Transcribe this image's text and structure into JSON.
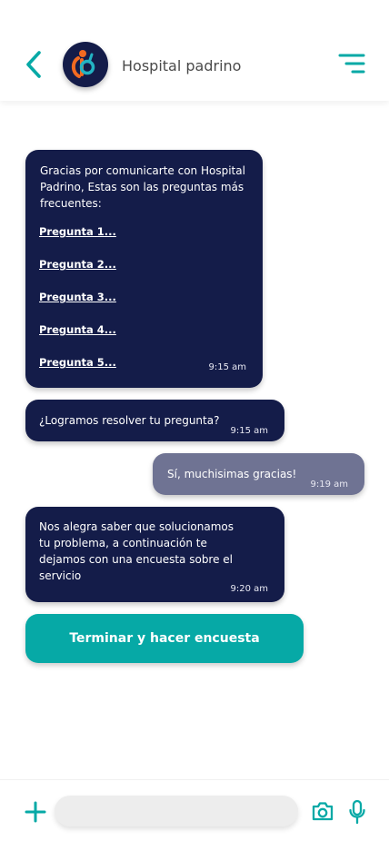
{
  "colors": {
    "accent": "#06a9a6",
    "bot_bubble": "#141c49",
    "user_bubble": "#6f7393",
    "logo_orange": "#f26a21",
    "logo_teal": "#23b3c3"
  },
  "header": {
    "back_icon": "chevron-left-icon",
    "title": "Hospital padrino",
    "menu_icon": "filter-menu-icon"
  },
  "messages": {
    "welcome": {
      "intro": "Gracias por comunicarte con Hospital Padrino, Estas son las preguntas más frecuentes:",
      "questions": [
        "Pregunta 1...",
        "Pregunta 2...",
        "Pregunta 3...",
        "Pregunta 4...",
        "Pregunta 5..."
      ],
      "time": "9:15 am"
    },
    "resolved_question": {
      "text": "¿Logramos resolver tu pregunta?",
      "time": "9:15 am"
    },
    "user_reply": {
      "text": "Sí, muchisimas gracias!",
      "time": "9:19 am"
    },
    "survey_note": {
      "text": "Nos alegra saber que solucionamos tu problema, a continuación te dejamos con una encuesta sobre el servicio",
      "time": "9:20 am"
    }
  },
  "cta": {
    "label": "Terminar y hacer encuesta"
  },
  "composer": {
    "plus_icon": "plus-icon",
    "input_value": "",
    "camera_icon": "camera-icon",
    "mic_icon": "microphone-icon"
  }
}
